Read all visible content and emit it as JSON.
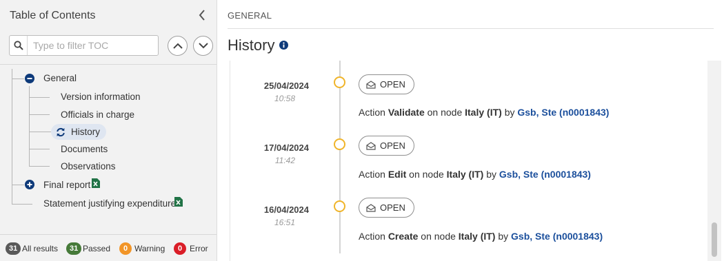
{
  "toc": {
    "title": "Table of Contents",
    "filter_placeholder": "Type to filter TOC",
    "items": [
      {
        "label": "General",
        "expanded": true
      },
      {
        "label": "Version information"
      },
      {
        "label": "Officials in charge"
      },
      {
        "label": "History",
        "selected": true
      },
      {
        "label": "Documents"
      },
      {
        "label": "Observations"
      },
      {
        "label": "Final report",
        "expanded": false
      },
      {
        "label": "Statement justifying expenditure"
      }
    ],
    "footer": {
      "all": {
        "count": "31",
        "label": "All results",
        "color": "#595959"
      },
      "passed": {
        "count": "31",
        "label": "Passed",
        "color": "#467a39"
      },
      "warning": {
        "count": "0",
        "label": "Warning",
        "color": "#f29527"
      },
      "error": {
        "count": "0",
        "label": "Error",
        "color": "#da1e28"
      }
    }
  },
  "breadcrumb": "GENERAL",
  "page_title": "History",
  "history": [
    {
      "date": "25/04/2024",
      "time": "10:58",
      "status": "OPEN",
      "action_prefix": "Action",
      "action": "Validate",
      "mid": "on node",
      "node": "Italy (IT)",
      "by": "by",
      "user": "Gsb, Ste (n0001843)"
    },
    {
      "date": "17/04/2024",
      "time": "11:42",
      "status": "OPEN",
      "action_prefix": "Action",
      "action": "Edit",
      "mid": "on node",
      "node": "Italy (IT)",
      "by": "by",
      "user": "Gsb, Ste (n0001843)"
    },
    {
      "date": "16/04/2024",
      "time": "16:51",
      "status": "OPEN",
      "action_prefix": "Action",
      "action": "Create",
      "mid": "on node",
      "node": "Italy (IT)",
      "by": "by",
      "user": "Gsb, Ste (n0001843)"
    }
  ],
  "colors": {
    "accent": "#1b4f9c",
    "timeline_dot": "#f0b429",
    "excel_green": "#217346"
  }
}
